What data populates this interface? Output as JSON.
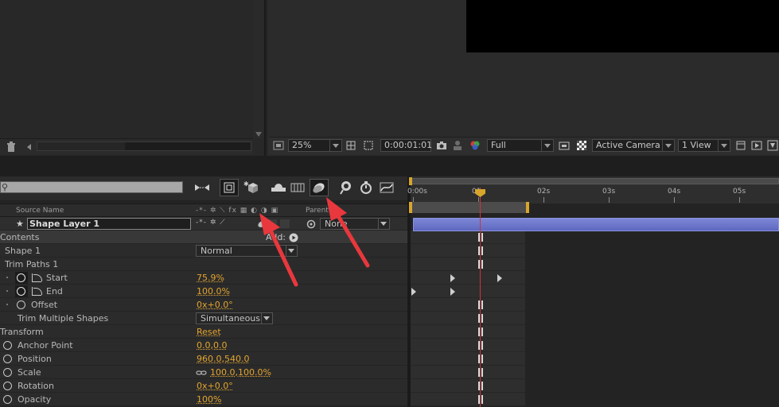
{
  "composition_footer": {
    "zoom": "25%",
    "timecode": "0:00:01:01",
    "resolution": "Full",
    "camera": "Active Camera",
    "view": "1 View"
  },
  "timeline": {
    "search_placeholder": "",
    "column_headers": {
      "source_name": "Source Name",
      "parent": "Parent"
    },
    "layer": {
      "name": "Shape Layer 1",
      "parent_value": "None"
    },
    "add_label": "Add:",
    "ruler_labels": [
      "0:00s",
      "01",
      "02s",
      "03s",
      "04s",
      "05s"
    ],
    "properties": [
      {
        "label": "Contents",
        "value": ""
      },
      {
        "label": "Shape 1",
        "value": "Normal"
      },
      {
        "label": "Trim Paths 1",
        "value": ""
      },
      {
        "label": "Start",
        "value": "75.9%"
      },
      {
        "label": "End",
        "value": "100.0%"
      },
      {
        "label": "Offset",
        "value": "0x+0.0°"
      },
      {
        "label": "Trim Multiple Shapes",
        "value": "Simultaneousl"
      },
      {
        "label": "Transform",
        "value": "Reset"
      },
      {
        "label": "Anchor Point",
        "value": "0.0,0.0"
      },
      {
        "label": "Position",
        "value": "960.0,540.0"
      },
      {
        "label": "Scale",
        "value": "100.0,100.0%"
      },
      {
        "label": "Rotation",
        "value": "0x+0.0°"
      },
      {
        "label": "Opacity",
        "value": "100%"
      }
    ]
  },
  "colors": {
    "accent_value": "#e4a52e",
    "layer_bar": "#6f79cc",
    "playhead": "#c9353a",
    "annotation_arrow": "#e8383d"
  },
  "icons": [
    "trash-icon",
    "camera-snapshot-icon",
    "region-of-interest-icon",
    "transparency-grid-icon",
    "graph-editor-icon",
    "motion-blur-icon",
    "stopwatch-icon",
    "pick-whip-icon"
  ]
}
